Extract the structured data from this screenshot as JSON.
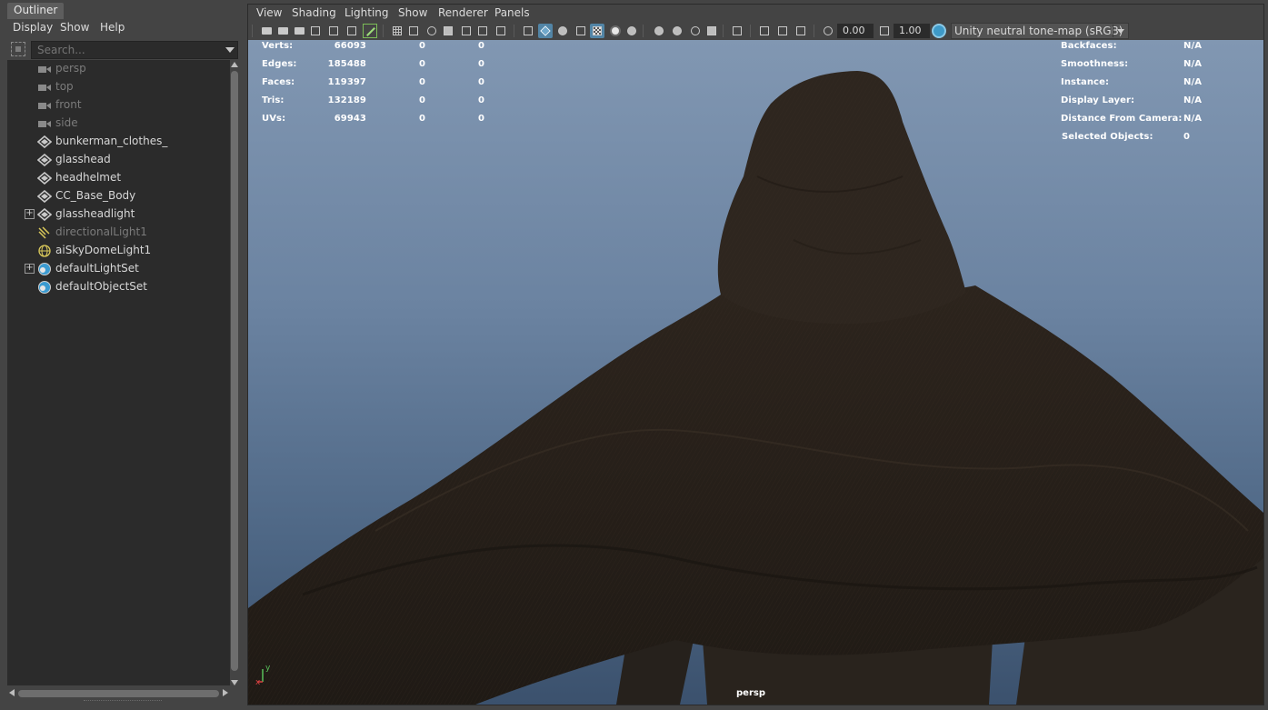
{
  "outliner": {
    "title": "Outliner",
    "menu": [
      "Display",
      "Show",
      "Help"
    ],
    "search_placeholder": "Search...",
    "items": [
      {
        "label": "persp",
        "icon": "camera-icon",
        "dim": true,
        "expandable": false
      },
      {
        "label": "top",
        "icon": "camera-icon",
        "dim": true,
        "expandable": false
      },
      {
        "label": "front",
        "icon": "camera-icon",
        "dim": true,
        "expandable": false
      },
      {
        "label": "side",
        "icon": "camera-icon",
        "dim": true,
        "expandable": false
      },
      {
        "label": "bunkerman_clothes_",
        "icon": "mesh-icon",
        "dim": false,
        "expandable": false
      },
      {
        "label": "glasshead",
        "icon": "mesh-icon",
        "dim": false,
        "expandable": false
      },
      {
        "label": "headhelmet",
        "icon": "mesh-icon",
        "dim": false,
        "expandable": false
      },
      {
        "label": "CC_Base_Body",
        "icon": "mesh-icon",
        "dim": false,
        "expandable": false
      },
      {
        "label": "glassheadlight",
        "icon": "mesh-icon",
        "dim": false,
        "expandable": true
      },
      {
        "label": "directionalLight1",
        "icon": "directional-light-icon",
        "dim": true,
        "expandable": false
      },
      {
        "label": "aiSkyDomeLight1",
        "icon": "skydome-icon",
        "dim": false,
        "expandable": false
      },
      {
        "label": "defaultLightSet",
        "icon": "set-icon",
        "dim": false,
        "expandable": true
      },
      {
        "label": "defaultObjectSet",
        "icon": "set-icon",
        "dim": false,
        "expandable": false
      }
    ]
  },
  "panel": {
    "menu": [
      "View",
      "Shading",
      "Lighting",
      "Show",
      "Renderer",
      "Panels"
    ],
    "exposure": "0.00",
    "gamma": "1.00",
    "tone_map": "Unity neutral tone-map (sRGB)",
    "camera_name": "persp"
  },
  "hud_left": [
    {
      "label": "Verts:",
      "v1": "66093",
      "v2": "0",
      "v3": "0"
    },
    {
      "label": "Edges:",
      "v1": "185488",
      "v2": "0",
      "v3": "0"
    },
    {
      "label": "Faces:",
      "v1": "119397",
      "v2": "0",
      "v3": "0"
    },
    {
      "label": "Tris:",
      "v1": "132189",
      "v2": "0",
      "v3": "0"
    },
    {
      "label": "UVs:",
      "v1": "69943",
      "v2": "0",
      "v3": "0"
    }
  ],
  "hud_right": [
    {
      "label": "Backfaces:",
      "value": "N/A"
    },
    {
      "label": "Smoothness:",
      "value": "N/A"
    },
    {
      "label": "Instance:",
      "value": "N/A"
    },
    {
      "label": "Display Layer:",
      "value": "N/A"
    },
    {
      "label": "Distance From Camera:",
      "value": "N/A"
    },
    {
      "label": "Selected Objects:",
      "value": "0"
    }
  ],
  "axis": {
    "y": "y",
    "x": "x"
  }
}
